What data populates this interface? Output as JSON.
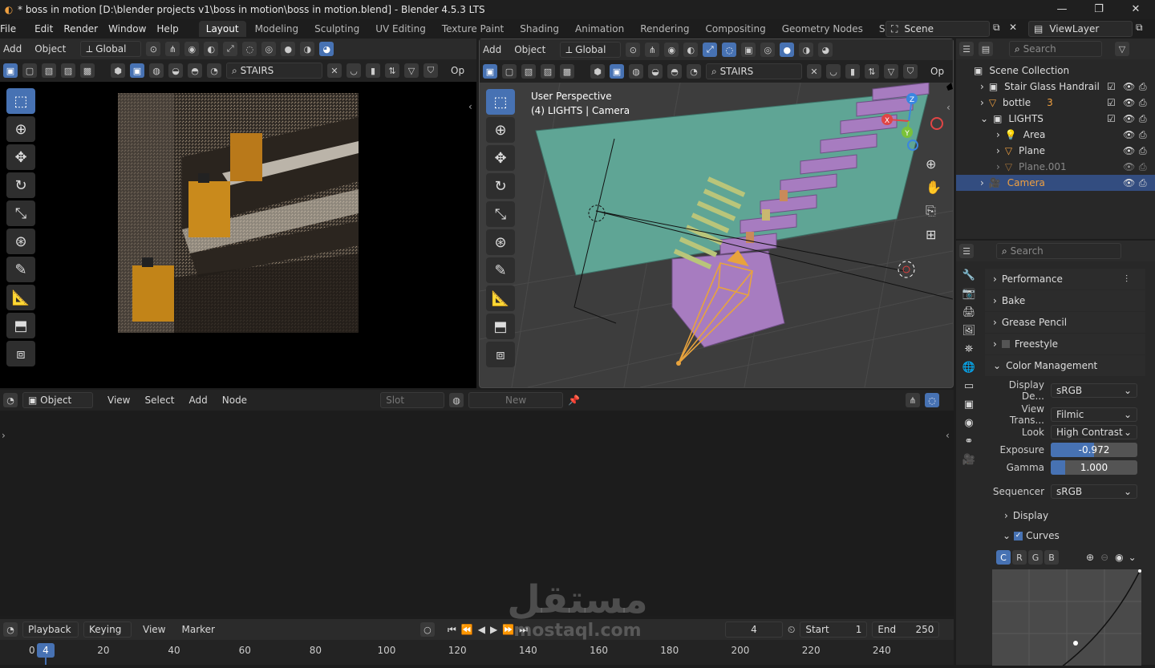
{
  "title": "* boss in motion [D:\\blender projects v1\\boss in motion\\boss in motion.blend] - Blender 4.5.3 LTS",
  "menu": [
    "File",
    "Edit",
    "Render",
    "Window",
    "Help"
  ],
  "workspaces": [
    "Layout",
    "Modeling",
    "Sculpting",
    "UV Editing",
    "Texture Paint",
    "Shading",
    "Animation",
    "Rendering",
    "Compositing",
    "Geometry Nodes",
    "Scripting"
  ],
  "scene": "Scene",
  "view_layer": "ViewLayer",
  "left_header": {
    "add": "Add",
    "object": "Object",
    "orientation": "Global",
    "search": "STAIRS",
    "op": "Op"
  },
  "viewport": {
    "add": "Add",
    "object": "Object",
    "orientation": "Global",
    "search": "STAIRS",
    "op": "Op",
    "perspective": "User Perspective",
    "info": "(4) LIGHTS | Camera",
    "axis_x": "X",
    "axis_y": "Y",
    "axis_z": "Z"
  },
  "outliner": {
    "search": "Search",
    "items": [
      {
        "label": "Scene Collection",
        "indent": 0
      },
      {
        "label": "Stair Glass Handrail",
        "indent": 1
      },
      {
        "label": "bottle",
        "indent": 1,
        "badge": "3"
      },
      {
        "label": "LIGHTS",
        "indent": 1
      },
      {
        "label": "Area",
        "indent": 2
      },
      {
        "label": "Plane",
        "indent": 2
      },
      {
        "label": "Plane.001",
        "indent": 2
      },
      {
        "label": "Camera",
        "indent": 1,
        "selected": true
      }
    ]
  },
  "properties": {
    "search": "Search",
    "panels": [
      "Performance",
      "Bake",
      "Grease Pencil",
      "Freestyle",
      "Color Management"
    ],
    "display_device": {
      "label": "Display De...",
      "value": "sRGB"
    },
    "view_transform": {
      "label": "View Trans...",
      "value": "Filmic"
    },
    "look": {
      "label": "Look",
      "value": "High Contrast"
    },
    "exposure": {
      "label": "Exposure",
      "value": "-0.972",
      "fill": 0.5
    },
    "gamma": {
      "label": "Gamma",
      "value": "1.000",
      "fill": 0.17
    },
    "sequencer": {
      "label": "Sequencer",
      "value": "sRGB"
    },
    "display": "Display",
    "curves": "Curves",
    "channels": [
      "C",
      "R",
      "G",
      "B"
    ]
  },
  "node_editor": {
    "mode": "Object",
    "view": "View",
    "select": "Select",
    "add": "Add",
    "node": "Node",
    "slot": "Slot",
    "new": "New"
  },
  "timeline": {
    "playback": "Playback",
    "keying": "Keying",
    "view": "View",
    "marker": "Marker",
    "frame": "4",
    "start_label": "Start",
    "start": "1",
    "end_label": "End",
    "end": "250",
    "ticks": [
      "0",
      "20",
      "40",
      "60",
      "80",
      "100",
      "120",
      "140",
      "160",
      "180",
      "200",
      "220",
      "240"
    ]
  },
  "watermark": {
    "arabic": "مستقل",
    "latin": "mostaql.com"
  },
  "colors": {
    "accent": "#4772b3",
    "camera": "#e8a33d",
    "wall": "#5fa595",
    "stairs": "#a77cc0",
    "orange": "#f0a040"
  }
}
